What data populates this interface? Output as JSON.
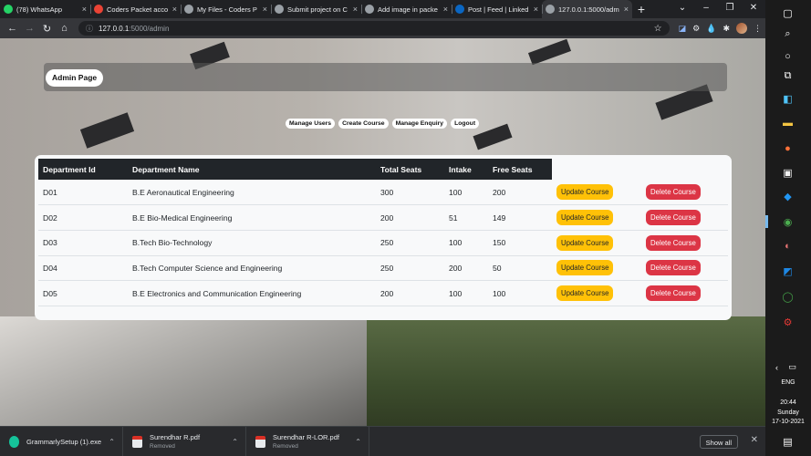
{
  "browser": {
    "tabs": [
      {
        "label": "(78) WhatsApp",
        "icon": "whatsapp-icon",
        "color": "#25d366",
        "active": false
      },
      {
        "label": "Coders Packet acco",
        "icon": "gmail-icon",
        "color": "#ea4335",
        "active": false
      },
      {
        "label": "My Files - Coders P",
        "icon": "globe-icon",
        "color": "#9aa0a6",
        "active": false
      },
      {
        "label": "Submit project on C",
        "icon": "globe-icon",
        "color": "#9aa0a6",
        "active": false
      },
      {
        "label": "Add image in packe",
        "icon": "globe-icon",
        "color": "#9aa0a6",
        "active": false
      },
      {
        "label": "Post | Feed | Linked",
        "icon": "linkedin-icon",
        "color": "#0a66c2",
        "active": false
      },
      {
        "label": "127.0.0.1:5000/adm",
        "icon": "globe-icon",
        "color": "#9aa0a6",
        "active": true
      }
    ],
    "new_tab": "+",
    "url_host": "127.0.0.1",
    "url_path": ":5000/admin"
  },
  "page": {
    "admin_label": "Admin Page",
    "nav": [
      "Manage Users",
      "Create Course",
      "Manage Enquiry",
      "Logout"
    ],
    "table": {
      "headers": [
        "Department Id",
        "Department Name",
        "Total Seats",
        "Intake",
        "Free Seats"
      ],
      "rows": [
        {
          "id": "D01",
          "name": "B.E Aeronautical Engineering",
          "total": "300",
          "intake": "100",
          "free": "200"
        },
        {
          "id": "D02",
          "name": "B.E Bio-Medical Engineering",
          "total": "200",
          "intake": "51",
          "free": "149"
        },
        {
          "id": "D03",
          "name": "B.Tech Bio-Technology",
          "total": "250",
          "intake": "100",
          "free": "150"
        },
        {
          "id": "D04",
          "name": "B.Tech Computer Science and Engineering",
          "total": "250",
          "intake": "200",
          "free": "50"
        },
        {
          "id": "D05",
          "name": "B.E Electronics and Communication Engineering",
          "total": "200",
          "intake": "100",
          "free": "100"
        }
      ],
      "update_label": "Update Course",
      "delete_label": "Delete Course"
    }
  },
  "downloads": {
    "items": [
      {
        "name": "GrammarlySetup (1).exe",
        "status": "",
        "icon": "grammarly-icon",
        "color": "#15c39a"
      },
      {
        "name": "Surendhar R.pdf",
        "status": "Removed",
        "icon": "pdf-icon",
        "color": "#e8eaed"
      },
      {
        "name": "Surendhar R-LOR.pdf",
        "status": "Removed",
        "icon": "pdf-icon",
        "color": "#e8eaed"
      }
    ],
    "show_all": "Show all"
  },
  "taskbar": {
    "language": "ENG",
    "time": "20:44",
    "day": "Sunday",
    "date": "17-10-2021"
  },
  "colors": {
    "update_button": "#ffc107",
    "delete_button": "#dc3545",
    "table_header": "#212529"
  }
}
